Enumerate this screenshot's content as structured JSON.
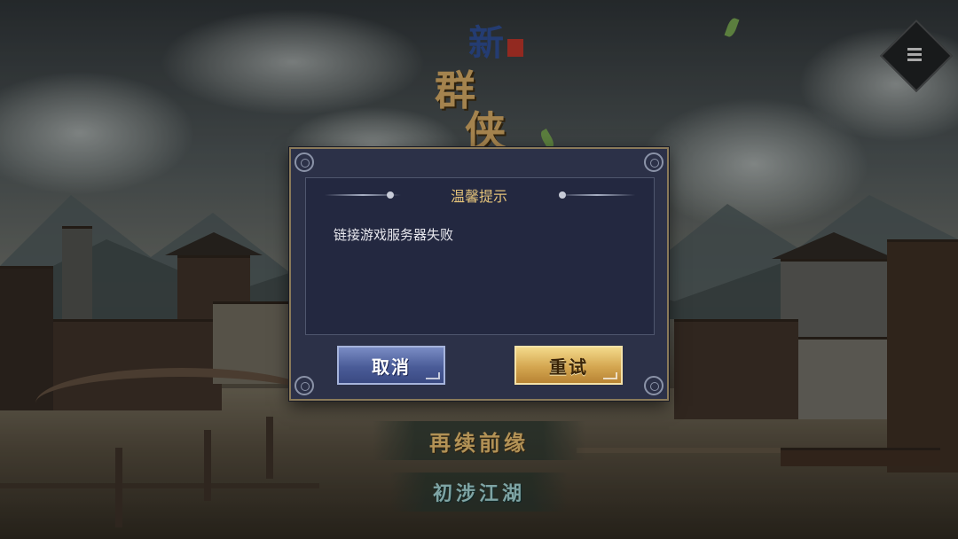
{
  "logo": {
    "char_1": "新",
    "char_2": "群",
    "char_3": "侠"
  },
  "menu": {
    "icon": "menu-list-icon"
  },
  "main_menu": {
    "continue_label": "再续前缘",
    "new_game_label": "初涉江湖"
  },
  "dialog": {
    "title": "温馨提示",
    "message": "链接游戏服务器失败",
    "cancel_label": "取消",
    "retry_label": "重试"
  },
  "colors": {
    "dialog_bg": "#2c3148",
    "title_gold": "#e3c27a",
    "cancel_blue": "#4a5c98",
    "retry_gold": "#d4a650"
  }
}
